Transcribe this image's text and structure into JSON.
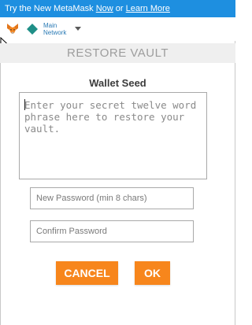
{
  "banner": {
    "prefix": "Try the New MetaMask ",
    "now_link": "Now",
    "connector": " or ",
    "learn_link": "Learn More"
  },
  "header": {
    "network_label": "Main Network",
    "fox_icon": "metamask-fox-icon",
    "network_icon": "ethereum-diamond-icon",
    "dropdown_icon": "caret-down-icon"
  },
  "page": {
    "title": "RESTORE VAULT"
  },
  "form": {
    "seed_label": "Wallet Seed",
    "seed_placeholder": "Enter your secret twelve word phrase here to restore your vault.",
    "seed_value": "",
    "new_password_placeholder": "New Password (min 8 chars)",
    "new_password_value": "",
    "confirm_password_placeholder": "Confirm Password",
    "confirm_password_value": ""
  },
  "actions": {
    "cancel_label": "CANCEL",
    "ok_label": "OK"
  },
  "colors": {
    "banner": "#1e8fe0",
    "accent_orange": "#f7861c",
    "title_text": "#9d9d9d",
    "network_teal": "#1f8f87"
  }
}
